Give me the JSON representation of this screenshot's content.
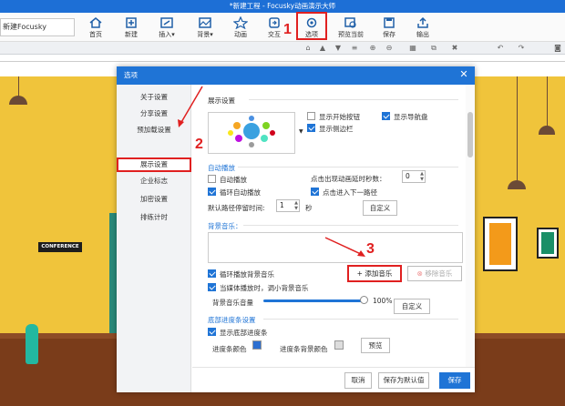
{
  "window": {
    "title": "*新建工程 - Focusky动画演示大师"
  },
  "ribbon": {
    "doc_name": "新建Focusky",
    "buttons": [
      {
        "label": "首页"
      },
      {
        "label": "新建"
      },
      {
        "label": "插入▾"
      },
      {
        "label": "背景▾"
      },
      {
        "label": "动画"
      },
      {
        "label": "交互"
      },
      {
        "label": "选项"
      },
      {
        "label": "预览当前"
      },
      {
        "label": "保存"
      },
      {
        "label": "输出"
      }
    ]
  },
  "annotations": {
    "step1": "1",
    "step2": "2",
    "step3": "3"
  },
  "scene": {
    "sign": "CONFERENCE"
  },
  "dialog": {
    "title": "选项",
    "sidebar": [
      "关于设置",
      "分享设置",
      "预加载设置",
      "展示设置",
      "企业标志",
      "加密设置",
      "排练计时"
    ],
    "selected": "展示设置",
    "display_section": "展示设置",
    "checkboxes_top": [
      {
        "label": "显示开始按钮",
        "checked": false
      },
      {
        "label": "显示导航盘",
        "checked": true
      },
      {
        "label": "显示侧边栏",
        "checked": true
      }
    ],
    "autoplay": {
      "title": "自动播放",
      "auto": {
        "label": "自动播放",
        "checked": false
      },
      "loop": {
        "label": "循环自动播放",
        "checked": true
      },
      "click_delay_label": "点击出现动画延时秒数：",
      "click_delay_value": "0",
      "click_next": {
        "label": "点击进入下一路径",
        "checked": true
      },
      "default_stay_label": "默认路径停留时间:",
      "default_stay_value": "1",
      "default_stay_unit": "秒",
      "custom_label": "自定义"
    },
    "bgmusic": {
      "title": "背景音乐：",
      "loop": {
        "label": "循环播放背景音乐",
        "checked": true
      },
      "reduce": {
        "label": "当媒体播放时，调小背景音乐",
        "checked": true
      },
      "add_label": "添加音乐",
      "remove_label": "移除音乐",
      "volume_label": "背景音乐音量",
      "volume_value": "100%",
      "volume_fraction": 1.0,
      "custom_label": "自定义"
    },
    "progress": {
      "title": "底部进度条设置",
      "show": {
        "label": "显示底部进度条",
        "checked": true
      },
      "color_label": "进度条颜色",
      "bg_color_label": "进度条背景颜色",
      "preview_label": "预览"
    },
    "footer": {
      "cancel": "取消",
      "save_default": "保存为默认值",
      "save": "保存"
    }
  }
}
